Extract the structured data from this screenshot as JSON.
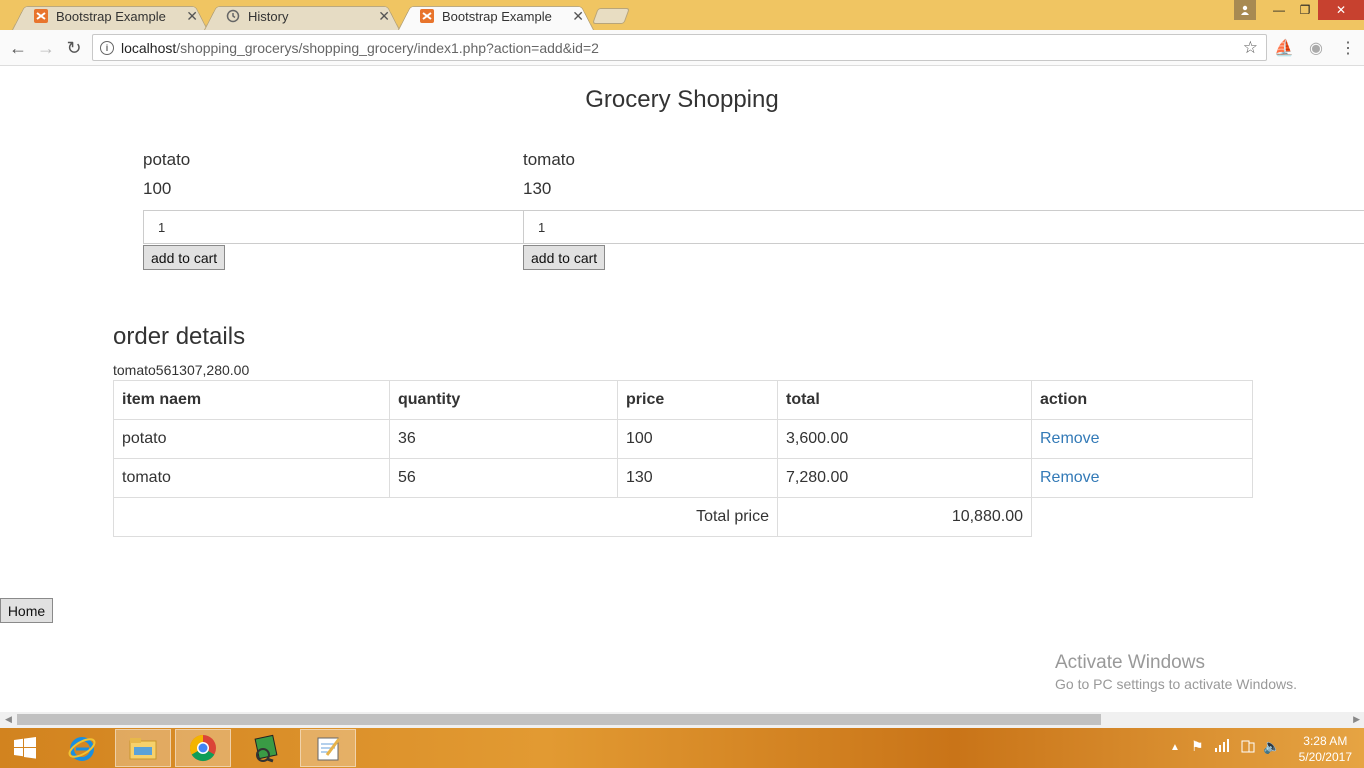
{
  "browser": {
    "tabs": [
      {
        "title": "Bootstrap Example",
        "active": false
      },
      {
        "title": "History",
        "active": false
      },
      {
        "title": "Bootstrap Example",
        "active": true
      }
    ],
    "url_host": "localhost",
    "url_rest": "/shopping_grocerys/shopping_grocery/index1.php?action=add&id=2"
  },
  "page": {
    "title": "Grocery Shopping",
    "products": [
      {
        "name": "potato",
        "price": "100",
        "qty": "1",
        "button": "add to cart"
      },
      {
        "name": "tomato",
        "price": "130",
        "qty": "1",
        "button": "add to cart"
      }
    ],
    "order_title": "order details",
    "debug_text": "tomato561307,280.00",
    "table": {
      "headers": [
        "item naem",
        "quantity",
        "price",
        "total",
        "action"
      ],
      "rows": [
        {
          "item": "potato",
          "quantity": "36",
          "price": "100",
          "total": "3,600.00",
          "action": "Remove"
        },
        {
          "item": "tomato",
          "quantity": "56",
          "price": "130",
          "total": "7,280.00",
          "action": "Remove"
        }
      ],
      "total_label": "Total price",
      "total_value": "10,880.00"
    },
    "home_button": "Home",
    "watermark_line1": "Activate Windows",
    "watermark_line2": "Go to PC settings to activate Windows."
  },
  "taskbar": {
    "time": "3:28 AM",
    "date": "5/20/2017"
  },
  "colors": {
    "link": "#337ab7",
    "tabstrip": "#f0c562",
    "taskbar": "#e29a32"
  }
}
